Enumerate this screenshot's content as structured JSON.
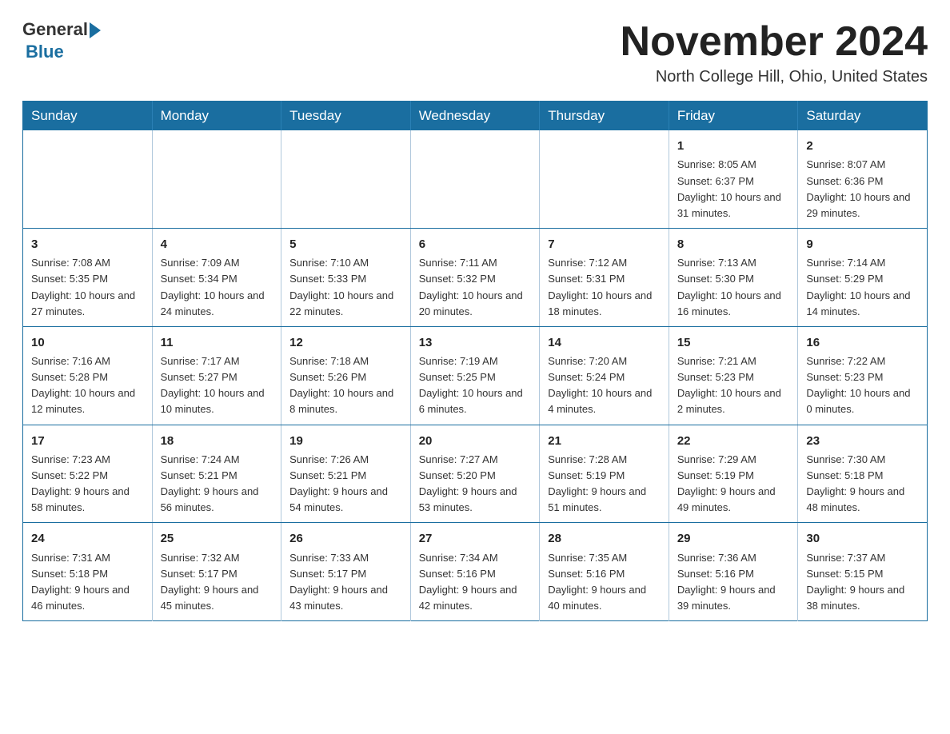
{
  "header": {
    "logo_text": "General",
    "logo_blue": "Blue",
    "month_title": "November 2024",
    "location": "North College Hill, Ohio, United States"
  },
  "weekdays": [
    "Sunday",
    "Monday",
    "Tuesday",
    "Wednesday",
    "Thursday",
    "Friday",
    "Saturday"
  ],
  "rows": [
    [
      {
        "day": "",
        "info": ""
      },
      {
        "day": "",
        "info": ""
      },
      {
        "day": "",
        "info": ""
      },
      {
        "day": "",
        "info": ""
      },
      {
        "day": "",
        "info": ""
      },
      {
        "day": "1",
        "info": "Sunrise: 8:05 AM\nSunset: 6:37 PM\nDaylight: 10 hours and 31 minutes."
      },
      {
        "day": "2",
        "info": "Sunrise: 8:07 AM\nSunset: 6:36 PM\nDaylight: 10 hours and 29 minutes."
      }
    ],
    [
      {
        "day": "3",
        "info": "Sunrise: 7:08 AM\nSunset: 5:35 PM\nDaylight: 10 hours and 27 minutes."
      },
      {
        "day": "4",
        "info": "Sunrise: 7:09 AM\nSunset: 5:34 PM\nDaylight: 10 hours and 24 minutes."
      },
      {
        "day": "5",
        "info": "Sunrise: 7:10 AM\nSunset: 5:33 PM\nDaylight: 10 hours and 22 minutes."
      },
      {
        "day": "6",
        "info": "Sunrise: 7:11 AM\nSunset: 5:32 PM\nDaylight: 10 hours and 20 minutes."
      },
      {
        "day": "7",
        "info": "Sunrise: 7:12 AM\nSunset: 5:31 PM\nDaylight: 10 hours and 18 minutes."
      },
      {
        "day": "8",
        "info": "Sunrise: 7:13 AM\nSunset: 5:30 PM\nDaylight: 10 hours and 16 minutes."
      },
      {
        "day": "9",
        "info": "Sunrise: 7:14 AM\nSunset: 5:29 PM\nDaylight: 10 hours and 14 minutes."
      }
    ],
    [
      {
        "day": "10",
        "info": "Sunrise: 7:16 AM\nSunset: 5:28 PM\nDaylight: 10 hours and 12 minutes."
      },
      {
        "day": "11",
        "info": "Sunrise: 7:17 AM\nSunset: 5:27 PM\nDaylight: 10 hours and 10 minutes."
      },
      {
        "day": "12",
        "info": "Sunrise: 7:18 AM\nSunset: 5:26 PM\nDaylight: 10 hours and 8 minutes."
      },
      {
        "day": "13",
        "info": "Sunrise: 7:19 AM\nSunset: 5:25 PM\nDaylight: 10 hours and 6 minutes."
      },
      {
        "day": "14",
        "info": "Sunrise: 7:20 AM\nSunset: 5:24 PM\nDaylight: 10 hours and 4 minutes."
      },
      {
        "day": "15",
        "info": "Sunrise: 7:21 AM\nSunset: 5:23 PM\nDaylight: 10 hours and 2 minutes."
      },
      {
        "day": "16",
        "info": "Sunrise: 7:22 AM\nSunset: 5:23 PM\nDaylight: 10 hours and 0 minutes."
      }
    ],
    [
      {
        "day": "17",
        "info": "Sunrise: 7:23 AM\nSunset: 5:22 PM\nDaylight: 9 hours and 58 minutes."
      },
      {
        "day": "18",
        "info": "Sunrise: 7:24 AM\nSunset: 5:21 PM\nDaylight: 9 hours and 56 minutes."
      },
      {
        "day": "19",
        "info": "Sunrise: 7:26 AM\nSunset: 5:21 PM\nDaylight: 9 hours and 54 minutes."
      },
      {
        "day": "20",
        "info": "Sunrise: 7:27 AM\nSunset: 5:20 PM\nDaylight: 9 hours and 53 minutes."
      },
      {
        "day": "21",
        "info": "Sunrise: 7:28 AM\nSunset: 5:19 PM\nDaylight: 9 hours and 51 minutes."
      },
      {
        "day": "22",
        "info": "Sunrise: 7:29 AM\nSunset: 5:19 PM\nDaylight: 9 hours and 49 minutes."
      },
      {
        "day": "23",
        "info": "Sunrise: 7:30 AM\nSunset: 5:18 PM\nDaylight: 9 hours and 48 minutes."
      }
    ],
    [
      {
        "day": "24",
        "info": "Sunrise: 7:31 AM\nSunset: 5:18 PM\nDaylight: 9 hours and 46 minutes."
      },
      {
        "day": "25",
        "info": "Sunrise: 7:32 AM\nSunset: 5:17 PM\nDaylight: 9 hours and 45 minutes."
      },
      {
        "day": "26",
        "info": "Sunrise: 7:33 AM\nSunset: 5:17 PM\nDaylight: 9 hours and 43 minutes."
      },
      {
        "day": "27",
        "info": "Sunrise: 7:34 AM\nSunset: 5:16 PM\nDaylight: 9 hours and 42 minutes."
      },
      {
        "day": "28",
        "info": "Sunrise: 7:35 AM\nSunset: 5:16 PM\nDaylight: 9 hours and 40 minutes."
      },
      {
        "day": "29",
        "info": "Sunrise: 7:36 AM\nSunset: 5:16 PM\nDaylight: 9 hours and 39 minutes."
      },
      {
        "day": "30",
        "info": "Sunrise: 7:37 AM\nSunset: 5:15 PM\nDaylight: 9 hours and 38 minutes."
      }
    ]
  ]
}
